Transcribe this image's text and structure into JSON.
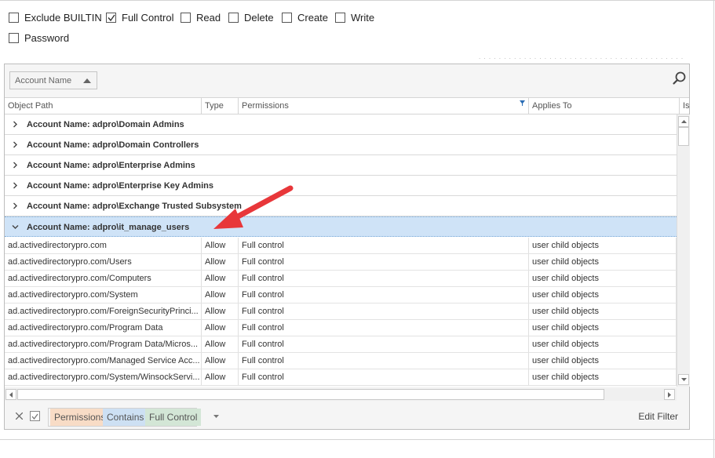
{
  "filters": {
    "row1": [
      {
        "label": "Exclude BUILTIN",
        "checked": false
      },
      {
        "label": "Full Control",
        "checked": true
      },
      {
        "label": "Read",
        "checked": false
      },
      {
        "label": "Delete",
        "checked": false
      },
      {
        "label": "Create",
        "checked": false
      },
      {
        "label": "Write",
        "checked": false
      }
    ],
    "row2": [
      {
        "label": "Password",
        "checked": false
      }
    ]
  },
  "groupby": {
    "chip_label": "Account Name"
  },
  "columns": {
    "object_path": "Object Path",
    "type": "Type",
    "permissions": "Permissions",
    "applies_to": "Applies To",
    "last_partial": "Is"
  },
  "groups": [
    {
      "label": "Account Name: adpro\\Domain Admins",
      "expanded": false
    },
    {
      "label": "Account Name: adpro\\Domain Controllers",
      "expanded": false
    },
    {
      "label": "Account Name: adpro\\Enterprise Admins",
      "expanded": false
    },
    {
      "label": "Account Name: adpro\\Enterprise Key Admins",
      "expanded": false
    },
    {
      "label": "Account Name: adpro\\Exchange Trusted Subsystem",
      "expanded": false
    },
    {
      "label": "Account Name: adpro\\it_manage_users",
      "expanded": true
    }
  ],
  "rows": [
    {
      "object_path": "ad.activedirectorypro.com",
      "type": "Allow",
      "permissions": "Full control",
      "applies_to": "user child objects"
    },
    {
      "object_path": "ad.activedirectorypro.com/Users",
      "type": "Allow",
      "permissions": "Full control",
      "applies_to": "user child objects"
    },
    {
      "object_path": "ad.activedirectorypro.com/Computers",
      "type": "Allow",
      "permissions": "Full control",
      "applies_to": "user child objects"
    },
    {
      "object_path": "ad.activedirectorypro.com/System",
      "type": "Allow",
      "permissions": "Full control",
      "applies_to": "user child objects"
    },
    {
      "object_path": "ad.activedirectorypro.com/ForeignSecurityPrinci...",
      "type": "Allow",
      "permissions": "Full control",
      "applies_to": "user child objects"
    },
    {
      "object_path": "ad.activedirectorypro.com/Program Data",
      "type": "Allow",
      "permissions": "Full control",
      "applies_to": "user child objects"
    },
    {
      "object_path": "ad.activedirectorypro.com/Program Data/Micros...",
      "type": "Allow",
      "permissions": "Full control",
      "applies_to": "user child objects"
    },
    {
      "object_path": "ad.activedirectorypro.com/Managed Service Acc...",
      "type": "Allow",
      "permissions": "Full control",
      "applies_to": "user child objects"
    },
    {
      "object_path": "ad.activedirectorypro.com/System/WinsockServi...",
      "type": "Allow",
      "permissions": "Full control",
      "applies_to": "user child objects"
    }
  ],
  "filter_bar": {
    "field": "Permissions",
    "operator": "Contains",
    "value": "Full Control",
    "edit_label": "Edit Filter",
    "colors": {
      "field": "#f8dcc6",
      "operator": "#cde0f3",
      "value": "#d3e6d6"
    }
  },
  "annotation": {
    "color": "#e8373a"
  }
}
